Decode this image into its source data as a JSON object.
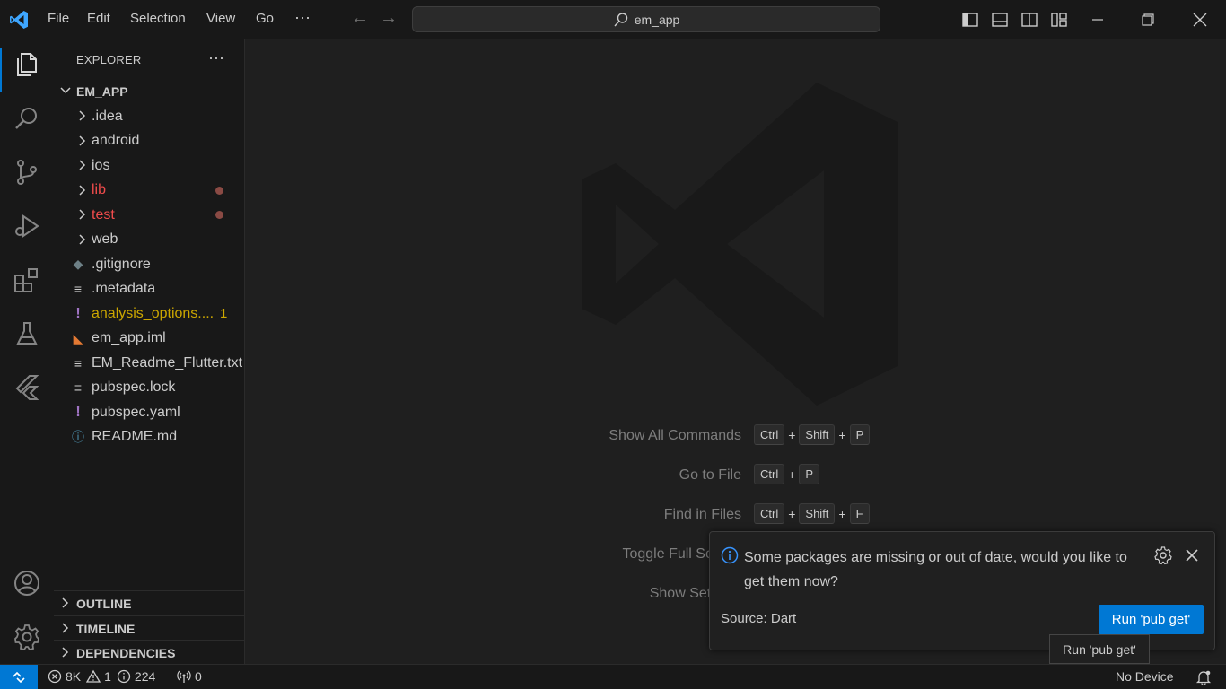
{
  "titlebar": {
    "menu": [
      "File",
      "Edit",
      "Selection",
      "View",
      "Go",
      "···"
    ],
    "search_text": "em_app"
  },
  "explorer": {
    "header": "EXPLORER",
    "more": "···",
    "root": "EM_APP",
    "folders": [
      {
        "label": ".idea",
        "color": "#cccccc",
        "modified": false
      },
      {
        "label": "android",
        "color": "#cccccc",
        "modified": false
      },
      {
        "label": "ios",
        "color": "#cccccc",
        "modified": false
      },
      {
        "label": "lib",
        "color": "#f14c4c",
        "modified": true
      },
      {
        "label": "test",
        "color": "#f14c4c",
        "modified": true
      },
      {
        "label": "web",
        "color": "#cccccc",
        "modified": false
      }
    ],
    "files": [
      {
        "label": ".gitignore",
        "icon": "git-icon",
        "color": "#cccccc"
      },
      {
        "label": ".metadata",
        "icon": "lines-icon",
        "color": "#cccccc"
      },
      {
        "label": "analysis_options....",
        "icon": "exclaim-icon",
        "color": "#cca700",
        "badge": "1"
      },
      {
        "label": "em_app.iml",
        "icon": "rss-icon",
        "color": "#cccccc"
      },
      {
        "label": "EM_Readme_Flutter.txt",
        "icon": "lines-icon",
        "color": "#cccccc"
      },
      {
        "label": "pubspec.lock",
        "icon": "lines-icon",
        "color": "#cccccc"
      },
      {
        "label": "pubspec.yaml",
        "icon": "exclaim-icon",
        "color": "#cccccc"
      },
      {
        "label": "README.md",
        "icon": "info-icon",
        "color": "#cccccc"
      }
    ],
    "sections": [
      "OUTLINE",
      "TIMELINE",
      "DEPENDENCIES"
    ]
  },
  "welcome": {
    "commands": [
      {
        "label": "Show All Commands",
        "keys": [
          "Ctrl",
          "Shift",
          "P"
        ]
      },
      {
        "label": "Go to File",
        "keys": [
          "Ctrl",
          "P"
        ]
      },
      {
        "label": "Find in Files",
        "keys": [
          "Ctrl",
          "Shift",
          "F"
        ]
      },
      {
        "label": "Toggle Full Screen",
        "keys": []
      },
      {
        "label": "Show Settings",
        "keys": []
      }
    ]
  },
  "notification": {
    "message": "Some packages are missing or out of date, would you like to get them now?",
    "source": "Source: Dart",
    "button": "Run 'pub get'",
    "tooltip": "Run 'pub get'"
  },
  "statusbar": {
    "errors": "8K",
    "warnings": "1",
    "infos": "224",
    "ports": "0",
    "device": "No Device"
  },
  "colors": {
    "accent": "#0078d4",
    "modified": "#f14c4c",
    "warning": "#cca700"
  }
}
